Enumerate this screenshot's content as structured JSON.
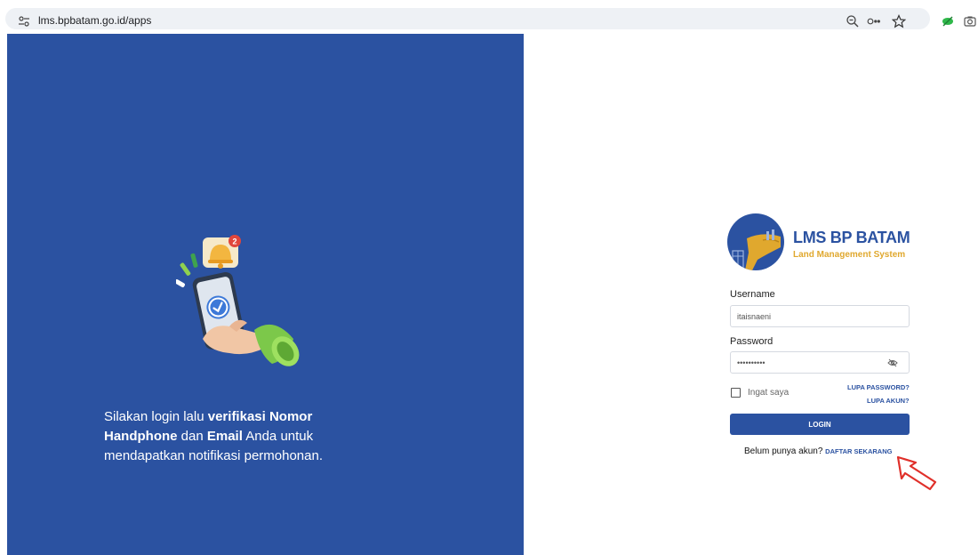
{
  "browser": {
    "url": "lms.bpbatam.go.id/apps",
    "icons": [
      "zoom-icon",
      "password-key-icon",
      "bookmark-star-icon",
      "extension-icon",
      "camera-icon"
    ]
  },
  "promo": {
    "text_1": "Silakan login lalu ",
    "bold_1": "verifikasi Nomor Handphone",
    "text_2": " dan ",
    "bold_2": "Email",
    "text_3": " Anda untuk mendapatkan notifikasi permohonan.",
    "badge_count": "2"
  },
  "logo": {
    "title": "LMS BP BATAM",
    "subtitle": "Land Management System"
  },
  "form": {
    "username_label": "Username",
    "username_value": "itaisnaeni",
    "password_label": "Password",
    "password_value": "••••••••••",
    "remember_label": "Ingat saya",
    "forgot_password": "LUPA PASSWORD?",
    "forgot_account": "LUPA AKUN?",
    "login_button": "LOGIN",
    "register_prompt": "Belum punya akun? ",
    "register_link": "DAFTAR SEKARANG"
  },
  "colors": {
    "brand_blue": "#2b52a1",
    "brand_gold": "#e0a82e",
    "annotation_red": "#e0302a"
  }
}
